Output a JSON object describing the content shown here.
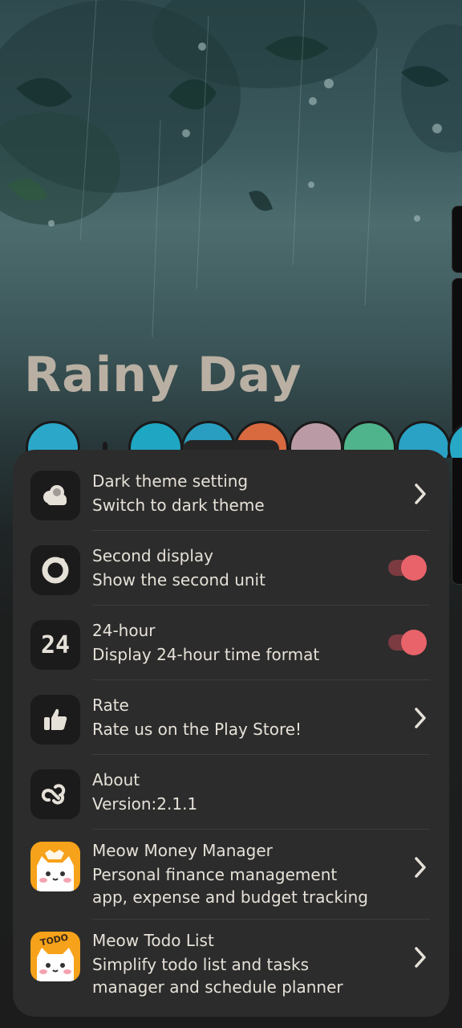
{
  "wallpaper": {
    "title": "Rainy Day"
  },
  "settings": {
    "items": [
      {
        "title": "Dark theme setting",
        "subtitle": "Switch to dark theme",
        "icon": "cloud-icon",
        "control": "chevron"
      },
      {
        "title": "Second display",
        "subtitle": "Show the second unit",
        "icon": "ring-icon",
        "control": "toggle",
        "on": true
      },
      {
        "title": "24-hour",
        "subtitle": "Display 24-hour time format",
        "icon": "24-icon",
        "icon_text": "24",
        "control": "toggle",
        "on": true
      },
      {
        "title": "Rate",
        "subtitle": "Rate us on the Play Store!",
        "icon": "thumbs-up-icon",
        "control": "chevron"
      },
      {
        "title": "About",
        "subtitle": "Version:2.1.1",
        "icon": "link-logo-icon",
        "control": "none"
      },
      {
        "title": "Meow Money Manager",
        "subtitle": "Personal finance management",
        "subtitle2": "app, expense and budget tracking",
        "icon": "cat-app-icon",
        "control": "chevron"
      },
      {
        "title": "Meow Todo List",
        "subtitle": "Simplify todo list and tasks",
        "subtitle2": "manager and schedule planner",
        "icon": "cat-todo-app-icon",
        "icon_text": "TODO",
        "control": "chevron"
      }
    ]
  },
  "colors": {
    "accent": "#e8636a",
    "sheet": "#2c2c2c",
    "title": "#b9b0a3",
    "app_icon": "#f6a21a"
  }
}
